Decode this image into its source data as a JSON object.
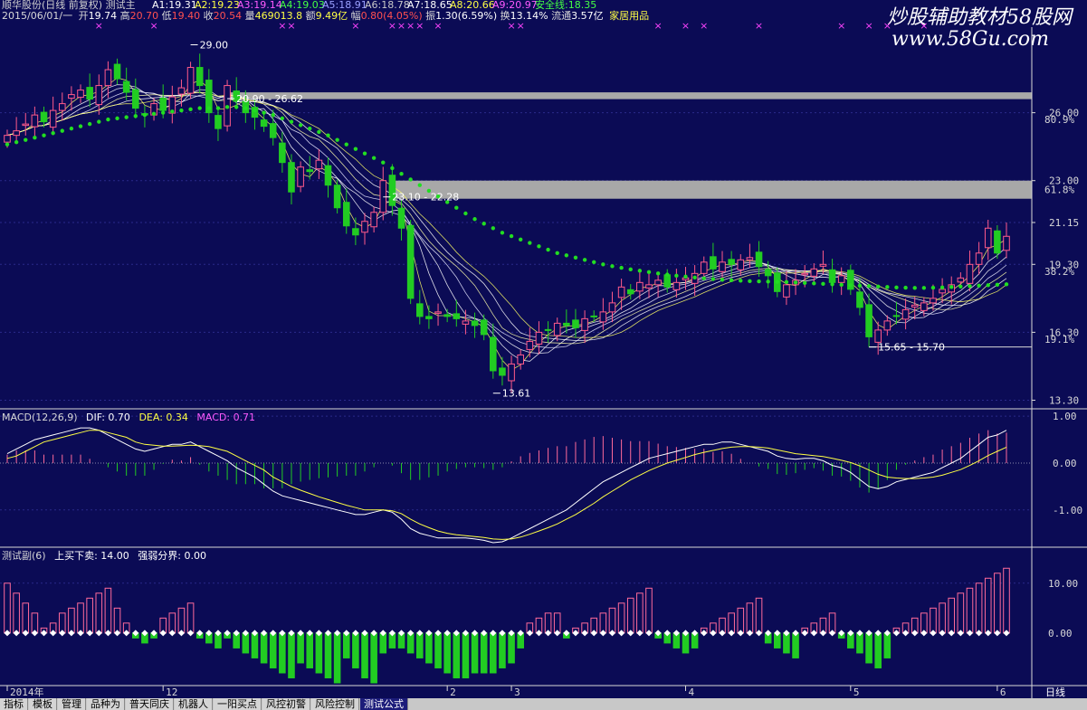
{
  "header": {
    "stock": "顺华股份(日线 前复权) 测试主",
    "date": "2015/06/01/一",
    "open_label": "开",
    "open": "19.74",
    "high_label": "高",
    "high": "20.70",
    "low_label": "低",
    "low": "19.40",
    "close_label": "收",
    "close": "20.54",
    "vol_label": "量",
    "vol": "469013.8",
    "amt_label": "额",
    "amt": "9.49亿",
    "chg_label": "幅",
    "chg": "0.80(4.05%)",
    "amp_label": "振",
    "amp": "1.30(6.59%)",
    "turn_label": "换",
    "turn": "13.14%",
    "float_label": "流通",
    "float": "3.57亿",
    "sector": "家居用品",
    "ma": [
      {
        "name": "A1:",
        "value": "19.31"
      },
      {
        "name": "A2:",
        "value": "19.23"
      },
      {
        "name": "A3:",
        "value": "19.14"
      },
      {
        "name": "A4:",
        "value": "19.03"
      },
      {
        "name": "A5:",
        "value": "18.91"
      },
      {
        "name": "A6:",
        "value": "18.78"
      },
      {
        "name": "A7:",
        "value": "18.65"
      },
      {
        "name": "A8:",
        "value": "20.66"
      },
      {
        "name": "A9:",
        "value": "20.97"
      },
      {
        "name": "安全线:",
        "value": "18.35"
      }
    ]
  },
  "watermark": "炒股辅助教材58股网",
  "watermark_url": "www.58Gu.com",
  "macd_header": {
    "title": "MACD(12,26,9)",
    "dif": "DIF: 0.70",
    "dea": "DEA: 0.34",
    "macd": "MACD: 0.71"
  },
  "sub_header": {
    "title": "测试副(6)",
    "a": "上买下卖: 14.00",
    "b": "强弱分界: 0.00"
  },
  "price_axis": [
    {
      "label": "26.00",
      "v": 26.0
    },
    {
      "label": "23.00",
      "v": 23.0
    },
    {
      "label": "21.15",
      "v": 21.15
    },
    {
      "label": "19.30",
      "v": 19.3
    },
    {
      "label": "16.30",
      "v": 16.3
    },
    {
      "label": "13.30",
      "v": 13.3
    }
  ],
  "pct_axis": [
    {
      "label": "80.9%",
      "v": 25.7
    },
    {
      "label": "61.8%",
      "v": 22.6
    },
    {
      "label": "38.2%",
      "v": 19.0
    },
    {
      "label": "19.1%",
      "v": 16.0
    }
  ],
  "macd_axis": [
    {
      "label": "1.00",
      "v": 1.0
    },
    {
      "label": "0.00",
      "v": 0.0
    },
    {
      "label": "-1.00",
      "v": -1.0
    }
  ],
  "sub_axis": [
    {
      "label": "10.00",
      "v": 10.0
    },
    {
      "label": "0.00",
      "v": 0.0
    }
  ],
  "date_ticks": [
    {
      "label": "2014年",
      "i": 0
    },
    {
      "label": "12",
      "i": 17
    },
    {
      "label": "2",
      "i": 48
    },
    {
      "label": "3",
      "i": 55
    },
    {
      "label": "4",
      "i": 74
    },
    {
      "label": "5",
      "i": 92
    },
    {
      "label": "6",
      "i": 108
    }
  ],
  "period": "日线",
  "tabs": [
    "指标",
    "模板",
    "管理",
    "品种为",
    "普天同庆",
    "机器人",
    "一阳买点",
    "风控初警",
    "风险控制",
    "测试公式"
  ],
  "active_tab": 9,
  "chart_data": {
    "type": "candlestick",
    "price_range": [
      13.0,
      29.7
    ],
    "macd_range": [
      -1.7,
      1.1
    ],
    "sub_range": [
      -10.0,
      14.5
    ],
    "annotations": [
      {
        "text": "29.00",
        "i": 20,
        "v": 29.0
      },
      {
        "text": "20.90 - 26.62",
        "i": 24,
        "v": 26.62
      },
      {
        "text": "23.10 - 22.28",
        "i": 41,
        "v": 22.28
      },
      {
        "text": "13.61",
        "i": 53,
        "v": 13.61
      },
      {
        "text": "15.65 - 15.70",
        "i": 94,
        "v": 15.65
      }
    ],
    "resistance_zones": [
      {
        "from_i": 24,
        "top": 26.9,
        "bottom": 26.6
      },
      {
        "from_i": 42,
        "top": 23.0,
        "bottom": 22.2
      }
    ],
    "support_line": {
      "from_i": 94,
      "v": 15.65
    },
    "closes": [
      25.0,
      25.2,
      25.5,
      25.9,
      25.6,
      26.1,
      26.4,
      26.8,
      27.0,
      26.6,
      27.2,
      27.9,
      27.5,
      26.9,
      26.2,
      25.9,
      26.4,
      26.1,
      26.7,
      27.1,
      28.0,
      27.2,
      26.0,
      25.3,
      27.2,
      26.5,
      26.0,
      25.8,
      25.4,
      24.9,
      23.8,
      22.5,
      23.6,
      23.4,
      23.9,
      22.8,
      21.8,
      21.0,
      20.6,
      21.2,
      21.6,
      23.0,
      21.9,
      20.9,
      17.8,
      17.0,
      16.9,
      17.2,
      17.0,
      16.9,
      16.8,
      16.6,
      16.2,
      14.6,
      14.4,
      14.9,
      15.3,
      15.9,
      16.3,
      16.4,
      16.7,
      16.6,
      16.5,
      16.9,
      17.0,
      17.2,
      17.6,
      18.3,
      18.0,
      18.5,
      18.4,
      18.6,
      18.3,
      18.5,
      18.7,
      18.9,
      19.4,
      19.1,
      19.4,
      19.3,
      19.5,
      19.6,
      19.2,
      18.8,
      18.1,
      18.4,
      18.6,
      18.9,
      19.1,
      19.3,
      18.5,
      18.8,
      18.2,
      17.4,
      16.1,
      16.4,
      16.8,
      17.0,
      17.3,
      17.5,
      17.6,
      17.8,
      18.2,
      18.4,
      18.7,
      19.3,
      19.8,
      20.9,
      19.8,
      20.54
    ],
    "safety_line": [
      24.6,
      24.7,
      24.8,
      24.9,
      25.0,
      25.1,
      25.2,
      25.3,
      25.4,
      25.5,
      25.6,
      25.7,
      25.75,
      25.8,
      25.85,
      25.9,
      25.95,
      26.0,
      26.05,
      26.1,
      26.15,
      26.2,
      26.2,
      26.2,
      26.25,
      26.25,
      26.2,
      26.1,
      26.0,
      25.9,
      25.75,
      25.6,
      25.45,
      25.3,
      25.15,
      25.0,
      24.8,
      24.6,
      24.4,
      24.2,
      24.0,
      23.8,
      23.55,
      23.3,
      23.05,
      22.8,
      22.55,
      22.3,
      22.05,
      21.8,
      21.55,
      21.3,
      21.1,
      20.9,
      20.7,
      20.55,
      20.4,
      20.25,
      20.1,
      19.95,
      19.8,
      19.7,
      19.6,
      19.5,
      19.4,
      19.3,
      19.22,
      19.15,
      19.08,
      19.02,
      18.96,
      18.9,
      18.85,
      18.8,
      18.76,
      18.72,
      18.68,
      18.65,
      18.62,
      18.6,
      18.58,
      18.56,
      18.55,
      18.54,
      18.53,
      18.52,
      18.5,
      18.48,
      18.46,
      18.44,
      18.42,
      18.4,
      18.38,
      18.36,
      18.34,
      18.32,
      18.3,
      18.28,
      18.27,
      18.26,
      18.26,
      18.27,
      18.28,
      18.3,
      18.32,
      18.34,
      18.36,
      18.38,
      18.4,
      18.42
    ],
    "macd_dif": [
      0.2,
      0.3,
      0.4,
      0.5,
      0.55,
      0.6,
      0.65,
      0.7,
      0.75,
      0.75,
      0.7,
      0.6,
      0.5,
      0.4,
      0.3,
      0.25,
      0.3,
      0.35,
      0.4,
      0.4,
      0.45,
      0.35,
      0.25,
      0.15,
      0.05,
      -0.1,
      -0.2,
      -0.3,
      -0.45,
      -0.6,
      -0.7,
      -0.75,
      -0.8,
      -0.85,
      -0.9,
      -0.95,
      -1.0,
      -1.05,
      -1.1,
      -1.1,
      -1.05,
      -1.0,
      -1.05,
      -1.2,
      -1.4,
      -1.5,
      -1.55,
      -1.6,
      -1.6,
      -1.6,
      -1.6,
      -1.62,
      -1.65,
      -1.7,
      -1.68,
      -1.6,
      -1.5,
      -1.4,
      -1.3,
      -1.2,
      -1.1,
      -1.0,
      -0.85,
      -0.7,
      -0.55,
      -0.4,
      -0.3,
      -0.2,
      -0.1,
      0.0,
      0.1,
      0.15,
      0.2,
      0.25,
      0.3,
      0.35,
      0.4,
      0.4,
      0.45,
      0.45,
      0.4,
      0.35,
      0.3,
      0.25,
      0.15,
      0.1,
      0.08,
      0.1,
      0.1,
      0.05,
      -0.05,
      -0.1,
      -0.2,
      -0.35,
      -0.5,
      -0.55,
      -0.5,
      -0.4,
      -0.35,
      -0.3,
      -0.25,
      -0.2,
      -0.1,
      0.0,
      0.1,
      0.25,
      0.4,
      0.55,
      0.6,
      0.7
    ],
    "macd_dea": [
      0.1,
      0.15,
      0.25,
      0.35,
      0.45,
      0.5,
      0.55,
      0.6,
      0.65,
      0.7,
      0.7,
      0.65,
      0.6,
      0.55,
      0.45,
      0.4,
      0.38,
      0.36,
      0.36,
      0.37,
      0.38,
      0.37,
      0.35,
      0.3,
      0.25,
      0.15,
      0.05,
      -0.05,
      -0.15,
      -0.3,
      -0.4,
      -0.5,
      -0.58,
      -0.65,
      -0.72,
      -0.78,
      -0.84,
      -0.9,
      -0.95,
      -1.0,
      -1.0,
      -1.0,
      -1.02,
      -1.08,
      -1.2,
      -1.3,
      -1.38,
      -1.45,
      -1.5,
      -1.53,
      -1.55,
      -1.57,
      -1.59,
      -1.62,
      -1.63,
      -1.62,
      -1.58,
      -1.52,
      -1.45,
      -1.38,
      -1.3,
      -1.2,
      -1.1,
      -0.98,
      -0.86,
      -0.72,
      -0.6,
      -0.48,
      -0.36,
      -0.26,
      -0.16,
      -0.08,
      0.0,
      0.06,
      0.12,
      0.18,
      0.23,
      0.27,
      0.31,
      0.34,
      0.35,
      0.35,
      0.34,
      0.32,
      0.28,
      0.24,
      0.2,
      0.18,
      0.16,
      0.14,
      0.1,
      0.06,
      0.01,
      -0.06,
      -0.15,
      -0.24,
      -0.3,
      -0.32,
      -0.33,
      -0.33,
      -0.32,
      -0.3,
      -0.26,
      -0.2,
      -0.14,
      -0.05,
      0.05,
      0.16,
      0.25,
      0.34
    ],
    "sub_values": [
      10,
      8,
      6,
      4,
      1,
      2,
      4,
      5,
      6,
      7,
      8,
      9,
      5,
      2,
      -1,
      -2,
      -1,
      3,
      4,
      5,
      6,
      -1,
      -2,
      -3,
      -1,
      -3,
      -4,
      -5,
      -6,
      -7,
      -8,
      -9,
      -6,
      -7,
      -8,
      -9,
      -10,
      -5,
      -7,
      -9,
      -10,
      -4,
      -3,
      -3,
      -4,
      -5,
      -6,
      -7,
      -8,
      -9,
      -9,
      -8,
      -8,
      -8,
      -7,
      -6,
      -3,
      2,
      3,
      4,
      4,
      -1,
      1,
      2,
      3,
      4,
      5,
      6,
      7,
      8,
      9,
      -1,
      -2,
      -3,
      -4,
      -3,
      1,
      2,
      3,
      4,
      5,
      6,
      7,
      -2,
      -3,
      -4,
      -5,
      1,
      2,
      3,
      4,
      -1,
      -3,
      -4,
      -6,
      -7,
      -5,
      1,
      2,
      3,
      4,
      5,
      6,
      7,
      8,
      9,
      10,
      11,
      12,
      13
    ]
  }
}
